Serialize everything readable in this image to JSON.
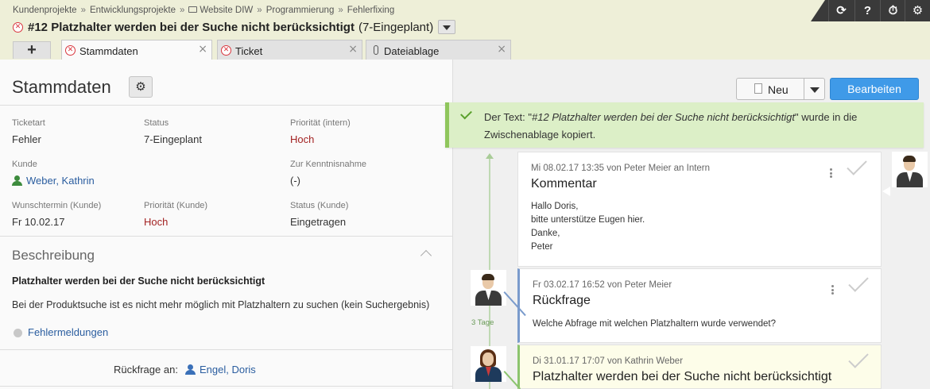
{
  "breadcrumb": {
    "items": [
      "Kundenprojekte",
      "Entwicklungsprojekte",
      "Website DIW",
      "Programmierung",
      "Fehlerfixing"
    ],
    "separator": "»"
  },
  "ticket": {
    "title": "#12 Platzhalter werden bei der Suche nicht berücksichtigt",
    "status": "(7-Eingeplant)"
  },
  "toolbar": {
    "sync_icon": "⟳",
    "help_icon": "?",
    "timer_icon": "⏱",
    "settings_icon": "⚙"
  },
  "tabs": {
    "add_label": "+",
    "items": [
      {
        "label": "Stammdaten",
        "icon": "error-circle-icon"
      },
      {
        "label": "Ticket",
        "icon": "error-circle-icon"
      },
      {
        "label": "Dateiablage",
        "icon": "paperclip-icon"
      }
    ]
  },
  "left": {
    "heading": "Stammdaten",
    "fields": {
      "ticketart_label": "Ticketart",
      "ticketart_value": "Fehler",
      "status_label": "Status",
      "status_value": "7-Eingeplant",
      "prio_intern_label": "Priorität (intern)",
      "prio_intern_value": "Hoch",
      "kunde_label": "Kunde",
      "kunde_value": "Weber, Kathrin",
      "kenntnis_label": "Zur Kenntnisnahme",
      "kenntnis_value": "(-)",
      "wunsch_label": "Wunschtermin (Kunde)",
      "wunsch_value": "Fr 10.02.17",
      "prio_kunde_label": "Priorität (Kunde)",
      "prio_kunde_value": "Hoch",
      "status_kunde_label": "Status (Kunde)",
      "status_kunde_value": "Eingetragen"
    },
    "beschreibung": {
      "title": "Beschreibung",
      "headline": "Platzhalter werden bei der Suche nicht berücksichtigt",
      "text": "Bei der Produktsuche ist es nicht mehr möglich mit Platzhaltern zu suchen (kein Suchergebnis)",
      "tag": "Fehlermeldungen"
    },
    "rueckfrage": {
      "label": "Rückfrage an:",
      "value": "Engel, Doris"
    }
  },
  "right": {
    "new_label": "Neu",
    "edit_label": "Bearbeiten",
    "toast": {
      "prefix": "Der Text: \"",
      "quoted": "#12 Platzhalter werden bei der Suche nicht berücksichtigt",
      "suffix": "\" wurde in die Zwischenablage kopiert."
    },
    "timeline_days": "3 Tage",
    "entries": [
      {
        "meta": "Mi 08.02.17 13:35 von Peter Meier an Intern",
        "title": "Kommentar",
        "body": [
          "Hallo Doris,",
          "bitte unterstütze Eugen hier.",
          "Danke,",
          "Peter"
        ]
      },
      {
        "meta": "Fr 03.02.17 16:52 von Peter Meier",
        "title": "Rückfrage",
        "body": [
          "Welche Abfrage mit welchen Platzhaltern wurde verwendet?"
        ]
      },
      {
        "meta": "Di 31.01.17 17:07 von Kathrin Weber",
        "title": "Platzhalter werden bei der Suche nicht berücksichtigt",
        "body": []
      }
    ]
  },
  "colors": {
    "header_bg": "#eeefd8",
    "accent_blue": "#3f9ae8",
    "priority_red": "#a32323",
    "link_blue": "#2a5d9f",
    "toast_bg": "#dcefc7",
    "toast_border": "#8fc65c"
  }
}
